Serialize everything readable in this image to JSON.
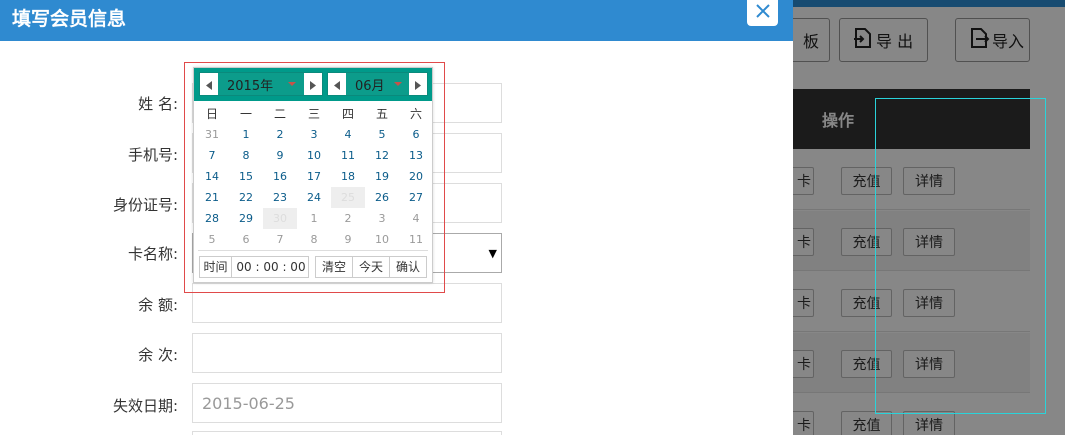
{
  "background": {
    "buttons": {
      "partial_label": "板",
      "export_label": "导 出",
      "import_label": "导入"
    },
    "table": {
      "action_header": "操作",
      "row_buttons": {
        "card": "卡",
        "charge": "充值",
        "detail": "详情"
      },
      "row_count": 5
    }
  },
  "modal": {
    "title": "填写会员信息",
    "close_icon": "close-icon",
    "fields": {
      "name": {
        "label": "姓 名:",
        "value": ""
      },
      "phone": {
        "label": "手机号:",
        "value": ""
      },
      "id_card": {
        "label": "身份证号:",
        "value": ""
      },
      "card_name": {
        "label": "卡名称:",
        "value": ""
      },
      "balance": {
        "label": "余 额:",
        "value": ""
      },
      "remaining_times": {
        "label": "余 次:",
        "value": ""
      },
      "expire_date": {
        "label": "失效日期:",
        "value": "2015-06-25"
      }
    }
  },
  "datepicker": {
    "year": "2015年",
    "month": "06月",
    "weekdays": [
      "日",
      "一",
      "二",
      "三",
      "四",
      "五",
      "六"
    ],
    "weeks": [
      [
        "31",
        "1",
        "2",
        "3",
        "4",
        "5",
        "6"
      ],
      [
        "7",
        "8",
        "9",
        "10",
        "11",
        "12",
        "13"
      ],
      [
        "14",
        "15",
        "16",
        "17",
        "18",
        "19",
        "20"
      ],
      [
        "21",
        "22",
        "23",
        "24",
        "25",
        "26",
        "27"
      ],
      [
        "28",
        "29",
        "30",
        "1",
        "2",
        "3",
        "4"
      ],
      [
        "5",
        "6",
        "7",
        "8",
        "9",
        "10",
        "11"
      ]
    ],
    "time_label": "时间",
    "time_value": "00 : 00 : 00",
    "clear_label": "清空",
    "today_label": "今天",
    "ok_label": "确认"
  },
  "colors": {
    "header_blue": "#2f8ad0",
    "picker_teal": "#009a8a",
    "outline_red": "#e04a4a",
    "frame_cyan": "#2ad3da"
  }
}
